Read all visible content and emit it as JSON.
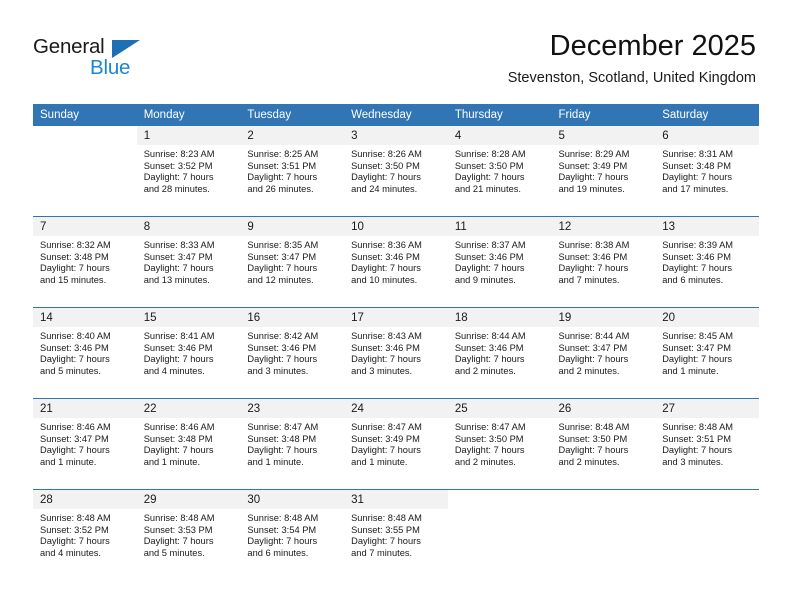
{
  "brand": {
    "word1": "General",
    "word2": "Blue",
    "triangle_color": "#1f6fb5",
    "blue_color": "#1c86d6"
  },
  "header": {
    "month_title": "December 2025",
    "location": "Stevenston, Scotland, United Kingdom",
    "header_bg": "#3175b4",
    "daynum_bg": "#f2f2f2"
  },
  "weekday_headers": [
    "Sunday",
    "Monday",
    "Tuesday",
    "Wednesday",
    "Thursday",
    "Friday",
    "Saturday"
  ],
  "weeks": [
    [
      {
        "day": "",
        "empty": true,
        "shaded": false,
        "sunrise": "",
        "sunset": "",
        "daylight_line1": "",
        "daylight_line2": ""
      },
      {
        "day": "1",
        "sunrise": "Sunrise: 8:23 AM",
        "sunset": "Sunset: 3:52 PM",
        "daylight_line1": "Daylight: 7 hours",
        "daylight_line2": "and 28 minutes."
      },
      {
        "day": "2",
        "sunrise": "Sunrise: 8:25 AM",
        "sunset": "Sunset: 3:51 PM",
        "daylight_line1": "Daylight: 7 hours",
        "daylight_line2": "and 26 minutes."
      },
      {
        "day": "3",
        "sunrise": "Sunrise: 8:26 AM",
        "sunset": "Sunset: 3:50 PM",
        "daylight_line1": "Daylight: 7 hours",
        "daylight_line2": "and 24 minutes."
      },
      {
        "day": "4",
        "sunrise": "Sunrise: 8:28 AM",
        "sunset": "Sunset: 3:50 PM",
        "daylight_line1": "Daylight: 7 hours",
        "daylight_line2": "and 21 minutes."
      },
      {
        "day": "5",
        "sunrise": "Sunrise: 8:29 AM",
        "sunset": "Sunset: 3:49 PM",
        "daylight_line1": "Daylight: 7 hours",
        "daylight_line2": "and 19 minutes."
      },
      {
        "day": "6",
        "sunrise": "Sunrise: 8:31 AM",
        "sunset": "Sunset: 3:48 PM",
        "daylight_line1": "Daylight: 7 hours",
        "daylight_line2": "and 17 minutes."
      }
    ],
    [
      {
        "day": "7",
        "sunrise": "Sunrise: 8:32 AM",
        "sunset": "Sunset: 3:48 PM",
        "daylight_line1": "Daylight: 7 hours",
        "daylight_line2": "and 15 minutes."
      },
      {
        "day": "8",
        "sunrise": "Sunrise: 8:33 AM",
        "sunset": "Sunset: 3:47 PM",
        "daylight_line1": "Daylight: 7 hours",
        "daylight_line2": "and 13 minutes."
      },
      {
        "day": "9",
        "sunrise": "Sunrise: 8:35 AM",
        "sunset": "Sunset: 3:47 PM",
        "daylight_line1": "Daylight: 7 hours",
        "daylight_line2": "and 12 minutes."
      },
      {
        "day": "10",
        "sunrise": "Sunrise: 8:36 AM",
        "sunset": "Sunset: 3:46 PM",
        "daylight_line1": "Daylight: 7 hours",
        "daylight_line2": "and 10 minutes."
      },
      {
        "day": "11",
        "sunrise": "Sunrise: 8:37 AM",
        "sunset": "Sunset: 3:46 PM",
        "daylight_line1": "Daylight: 7 hours",
        "daylight_line2": "and 9 minutes."
      },
      {
        "day": "12",
        "sunrise": "Sunrise: 8:38 AM",
        "sunset": "Sunset: 3:46 PM",
        "daylight_line1": "Daylight: 7 hours",
        "daylight_line2": "and 7 minutes."
      },
      {
        "day": "13",
        "sunrise": "Sunrise: 8:39 AM",
        "sunset": "Sunset: 3:46 PM",
        "daylight_line1": "Daylight: 7 hours",
        "daylight_line2": "and 6 minutes."
      }
    ],
    [
      {
        "day": "14",
        "sunrise": "Sunrise: 8:40 AM",
        "sunset": "Sunset: 3:46 PM",
        "daylight_line1": "Daylight: 7 hours",
        "daylight_line2": "and 5 minutes."
      },
      {
        "day": "15",
        "sunrise": "Sunrise: 8:41 AM",
        "sunset": "Sunset: 3:46 PM",
        "daylight_line1": "Daylight: 7 hours",
        "daylight_line2": "and 4 minutes."
      },
      {
        "day": "16",
        "sunrise": "Sunrise: 8:42 AM",
        "sunset": "Sunset: 3:46 PM",
        "daylight_line1": "Daylight: 7 hours",
        "daylight_line2": "and 3 minutes."
      },
      {
        "day": "17",
        "sunrise": "Sunrise: 8:43 AM",
        "sunset": "Sunset: 3:46 PM",
        "daylight_line1": "Daylight: 7 hours",
        "daylight_line2": "and 3 minutes."
      },
      {
        "day": "18",
        "sunrise": "Sunrise: 8:44 AM",
        "sunset": "Sunset: 3:46 PM",
        "daylight_line1": "Daylight: 7 hours",
        "daylight_line2": "and 2 minutes."
      },
      {
        "day": "19",
        "sunrise": "Sunrise: 8:44 AM",
        "sunset": "Sunset: 3:47 PM",
        "daylight_line1": "Daylight: 7 hours",
        "daylight_line2": "and 2 minutes."
      },
      {
        "day": "20",
        "sunrise": "Sunrise: 8:45 AM",
        "sunset": "Sunset: 3:47 PM",
        "daylight_line1": "Daylight: 7 hours",
        "daylight_line2": "and 1 minute."
      }
    ],
    [
      {
        "day": "21",
        "sunrise": "Sunrise: 8:46 AM",
        "sunset": "Sunset: 3:47 PM",
        "daylight_line1": "Daylight: 7 hours",
        "daylight_line2": "and 1 minute."
      },
      {
        "day": "22",
        "sunrise": "Sunrise: 8:46 AM",
        "sunset": "Sunset: 3:48 PM",
        "daylight_line1": "Daylight: 7 hours",
        "daylight_line2": "and 1 minute."
      },
      {
        "day": "23",
        "sunrise": "Sunrise: 8:47 AM",
        "sunset": "Sunset: 3:48 PM",
        "daylight_line1": "Daylight: 7 hours",
        "daylight_line2": "and 1 minute."
      },
      {
        "day": "24",
        "sunrise": "Sunrise: 8:47 AM",
        "sunset": "Sunset: 3:49 PM",
        "daylight_line1": "Daylight: 7 hours",
        "daylight_line2": "and 1 minute."
      },
      {
        "day": "25",
        "sunrise": "Sunrise: 8:47 AM",
        "sunset": "Sunset: 3:50 PM",
        "daylight_line1": "Daylight: 7 hours",
        "daylight_line2": "and 2 minutes."
      },
      {
        "day": "26",
        "sunrise": "Sunrise: 8:48 AM",
        "sunset": "Sunset: 3:50 PM",
        "daylight_line1": "Daylight: 7 hours",
        "daylight_line2": "and 2 minutes."
      },
      {
        "day": "27",
        "sunrise": "Sunrise: 8:48 AM",
        "sunset": "Sunset: 3:51 PM",
        "daylight_line1": "Daylight: 7 hours",
        "daylight_line2": "and 3 minutes."
      }
    ],
    [
      {
        "day": "28",
        "sunrise": "Sunrise: 8:48 AM",
        "sunset": "Sunset: 3:52 PM",
        "daylight_line1": "Daylight: 7 hours",
        "daylight_line2": "and 4 minutes."
      },
      {
        "day": "29",
        "sunrise": "Sunrise: 8:48 AM",
        "sunset": "Sunset: 3:53 PM",
        "daylight_line1": "Daylight: 7 hours",
        "daylight_line2": "and 5 minutes."
      },
      {
        "day": "30",
        "sunrise": "Sunrise: 8:48 AM",
        "sunset": "Sunset: 3:54 PM",
        "daylight_line1": "Daylight: 7 hours",
        "daylight_line2": "and 6 minutes."
      },
      {
        "day": "31",
        "sunrise": "Sunrise: 8:48 AM",
        "sunset": "Sunset: 3:55 PM",
        "daylight_line1": "Daylight: 7 hours",
        "daylight_line2": "and 7 minutes."
      },
      {
        "day": "",
        "empty": true,
        "shaded": false,
        "sunrise": "",
        "sunset": "",
        "daylight_line1": "",
        "daylight_line2": ""
      },
      {
        "day": "",
        "empty": true,
        "shaded": false,
        "sunrise": "",
        "sunset": "",
        "daylight_line1": "",
        "daylight_line2": ""
      },
      {
        "day": "",
        "empty": true,
        "shaded": false,
        "sunrise": "",
        "sunset": "",
        "daylight_line1": "",
        "daylight_line2": ""
      }
    ]
  ]
}
